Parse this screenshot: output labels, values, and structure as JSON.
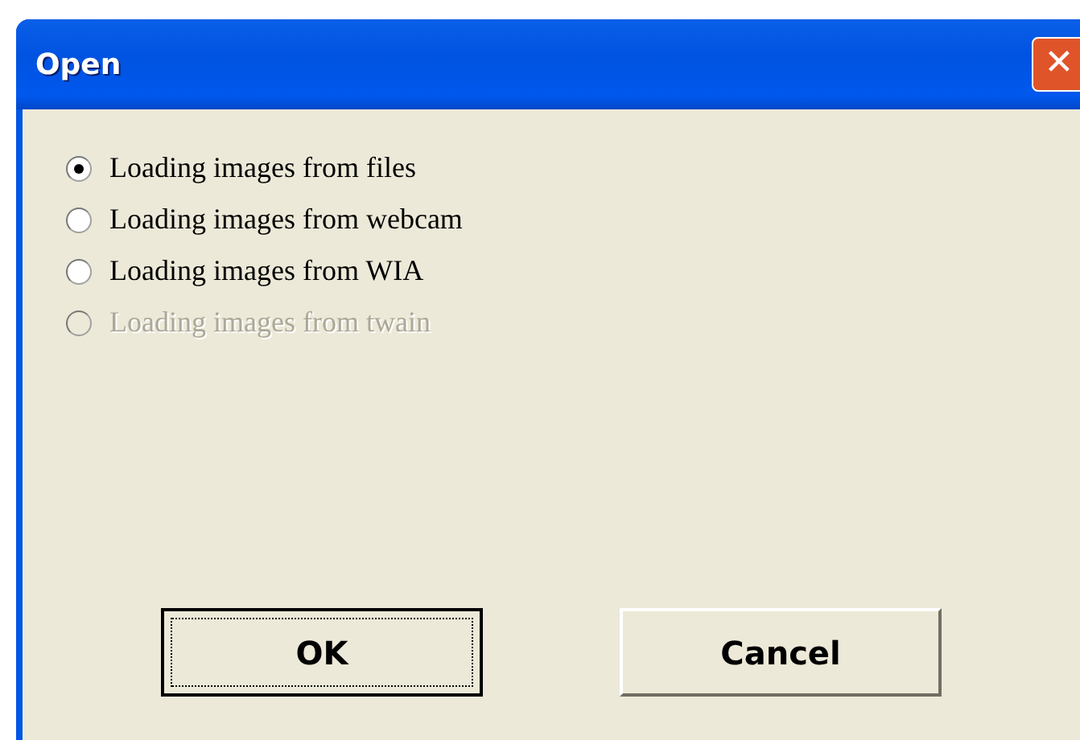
{
  "window": {
    "title": "Open",
    "close_label": "✕"
  },
  "options": [
    {
      "label": "Loading images from files",
      "selected": true,
      "disabled": false
    },
    {
      "label": "Loading images from webcam",
      "selected": false,
      "disabled": false
    },
    {
      "label": "Loading images from WIA",
      "selected": false,
      "disabled": false
    },
    {
      "label": "Loading images from twain",
      "selected": false,
      "disabled": true
    }
  ],
  "buttons": [
    {
      "label": "OK",
      "focused": true
    },
    {
      "label": "Cancel",
      "focused": false
    }
  ]
}
